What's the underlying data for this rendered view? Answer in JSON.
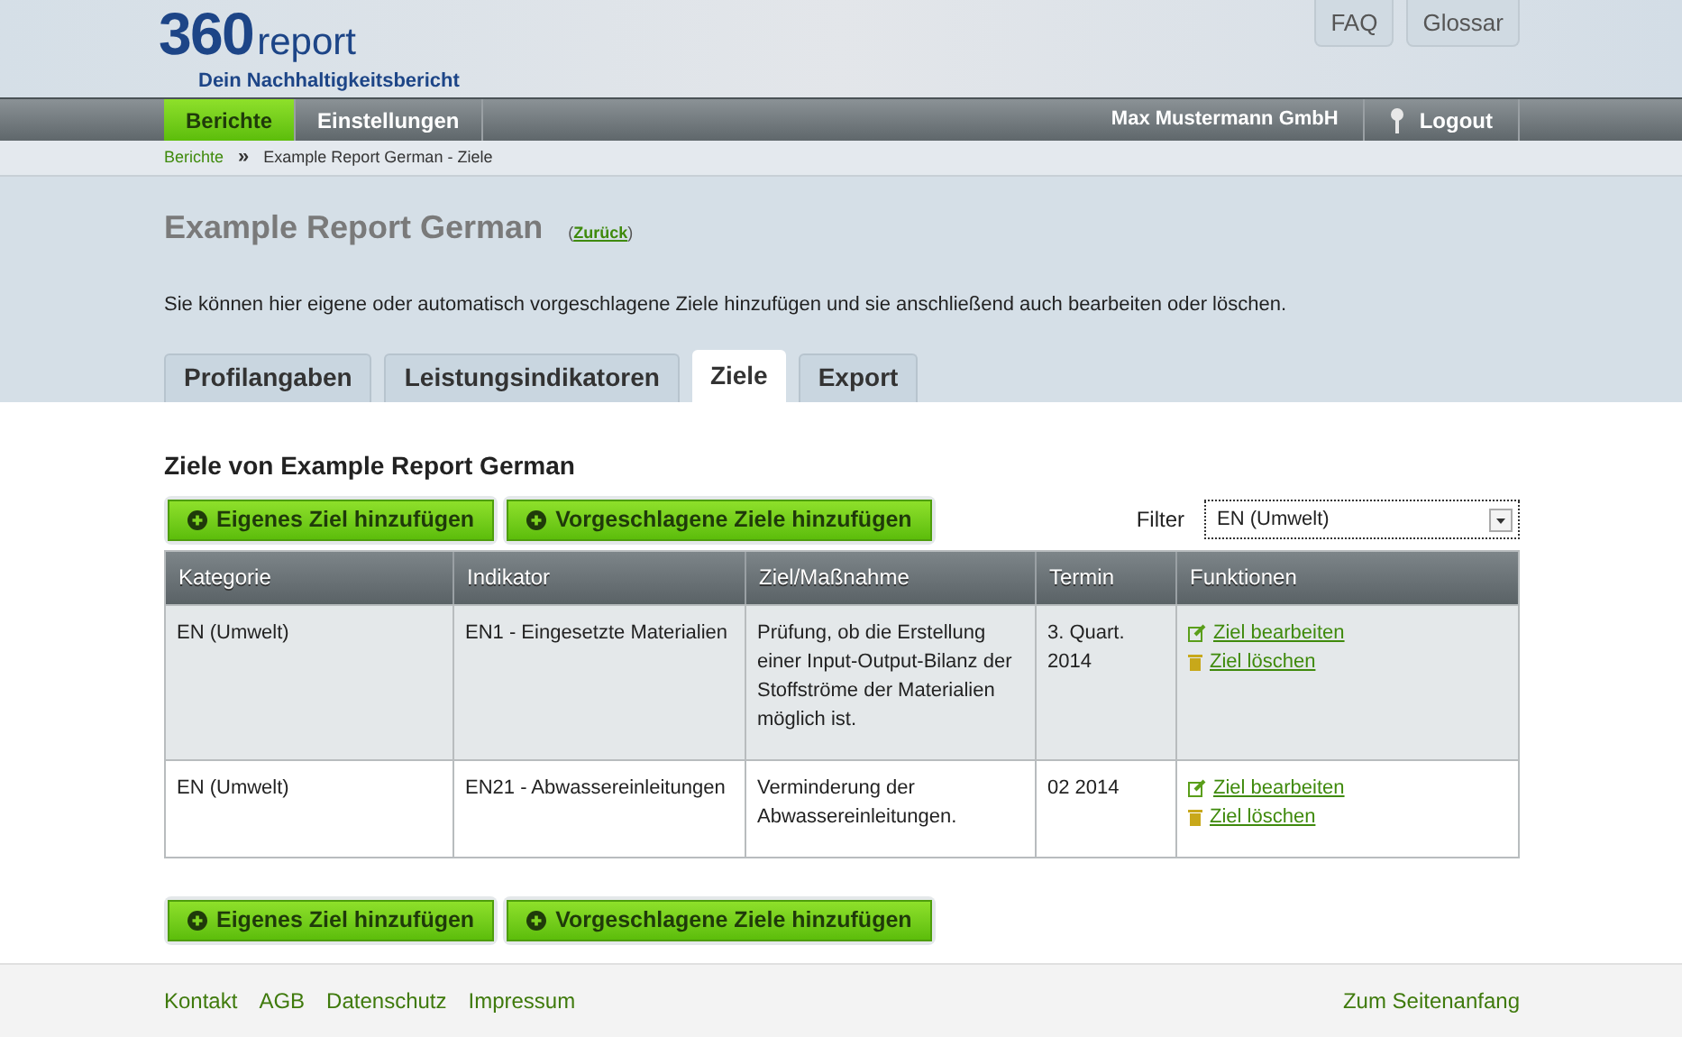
{
  "logo": {
    "number": "360",
    "word": "report",
    "tagline": "Dein Nachhaltigkeitsbericht"
  },
  "top_links": [
    "FAQ",
    "Glossar"
  ],
  "nav": {
    "items": [
      {
        "label": "Berichte",
        "selected": true
      },
      {
        "label": "Einstellungen",
        "selected": false
      }
    ],
    "user": "Max Mustermann GmbH",
    "logout": "Logout"
  },
  "breadcrumb": {
    "link": "Berichte",
    "separator": "»",
    "current": "Example Report German - Ziele"
  },
  "page": {
    "title": "Example Report German",
    "back_open": "(",
    "back": "Zurück",
    "back_close": ")",
    "description": "Sie können hier eigene oder automatisch vorgeschlagene Ziele hinzufügen und sie anschließend auch bearbeiten oder löschen."
  },
  "tabs": [
    {
      "label": "Profilangaben",
      "selected": false
    },
    {
      "label": "Leistungsindikatoren",
      "selected": false
    },
    {
      "label": "Ziele",
      "selected": true
    },
    {
      "label": "Export",
      "selected": false
    }
  ],
  "section_title": "Ziele von Example Report German",
  "buttons": [
    "Eigenes Ziel hinzufügen",
    "Vorgeschlagene Ziele hinzufügen"
  ],
  "filter": {
    "label": "Filter",
    "value": "EN (Umwelt)"
  },
  "table": {
    "columns": [
      "Kategorie",
      "Indikator",
      "Ziel/Maßnahme",
      "Termin",
      "Funktionen"
    ],
    "rows": [
      {
        "kategorie": "EN (Umwelt)",
        "indikator": "EN1 - Eingesetzte Materialien",
        "ziel": "Prüfung, ob die Erstellung einer Input-Output-Bilanz der Stoffströme der Materialien möglich ist.",
        "termin": "3. Quart. 2014",
        "edit": "Ziel bearbeiten",
        "delete": "Ziel löschen"
      },
      {
        "kategorie": "EN (Umwelt)",
        "indikator": "EN21 - Abwassereinleitungen",
        "ziel": "Verminderung der Abwassereinleitungen.",
        "termin": "02 2014",
        "edit": "Ziel bearbeiten",
        "delete": "Ziel löschen"
      }
    ]
  },
  "bottom_buttons": [
    "Eigenes Ziel hinzufügen",
    "Vorgeschlagene Ziele hinzufügen"
  ],
  "footer": {
    "links": [
      "Kontakt",
      "AGB",
      "Datenschutz",
      "Impressum"
    ],
    "top_link": "Zum Seitenanfang"
  }
}
